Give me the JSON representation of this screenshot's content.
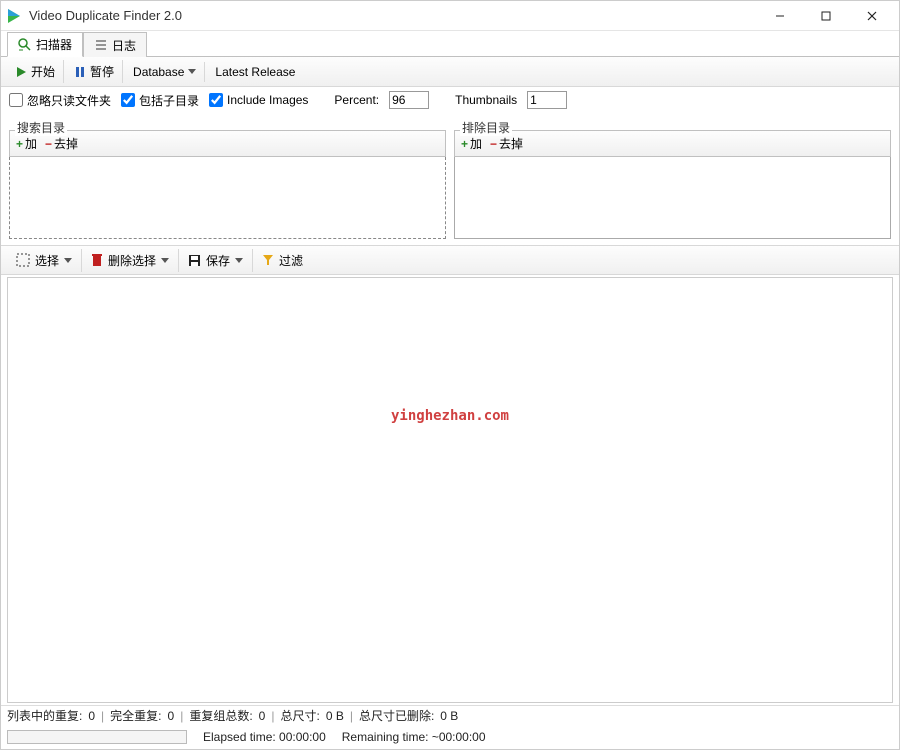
{
  "window": {
    "title": "Video Duplicate Finder 2.0"
  },
  "tabs": {
    "scanner": "扫描器",
    "log": "日志"
  },
  "toolbar": {
    "start": "开始",
    "pause": "暂停",
    "database": "Database",
    "latest": "Latest Release"
  },
  "options": {
    "ignore_readonly": "忽略只读文件夹",
    "include_subdirs": "包括子目录",
    "include_images": "Include Images",
    "percent_label": "Percent:",
    "percent_value": "96",
    "thumbnails_label": "Thumbnails",
    "thumbnails_value": "1"
  },
  "panels": {
    "search": {
      "title": "搜索目录",
      "add": "加",
      "remove": "去掉"
    },
    "exclude": {
      "title": "排除目录",
      "add": "加",
      "remove": "去掉"
    }
  },
  "actions": {
    "select": "选择",
    "delete_selection": "删除选择",
    "save": "保存",
    "filter": "过滤"
  },
  "watermark": "yinghezhan.com",
  "status": {
    "dup_in_list_label": "列表中的重复:",
    "dup_in_list": "0",
    "full_dup_label": "完全重复:",
    "full_dup": "0",
    "groups_label": "重复组总数:",
    "groups": "0",
    "total_size_label": "总尺寸:",
    "total_size": "0 B",
    "deleted_size_label": "总尺寸已删除:",
    "deleted_size": "0 B",
    "elapsed_label": "Elapsed time:",
    "elapsed": "00:00:00",
    "remaining_label": "Remaining time:",
    "remaining": "~00:00:00"
  }
}
